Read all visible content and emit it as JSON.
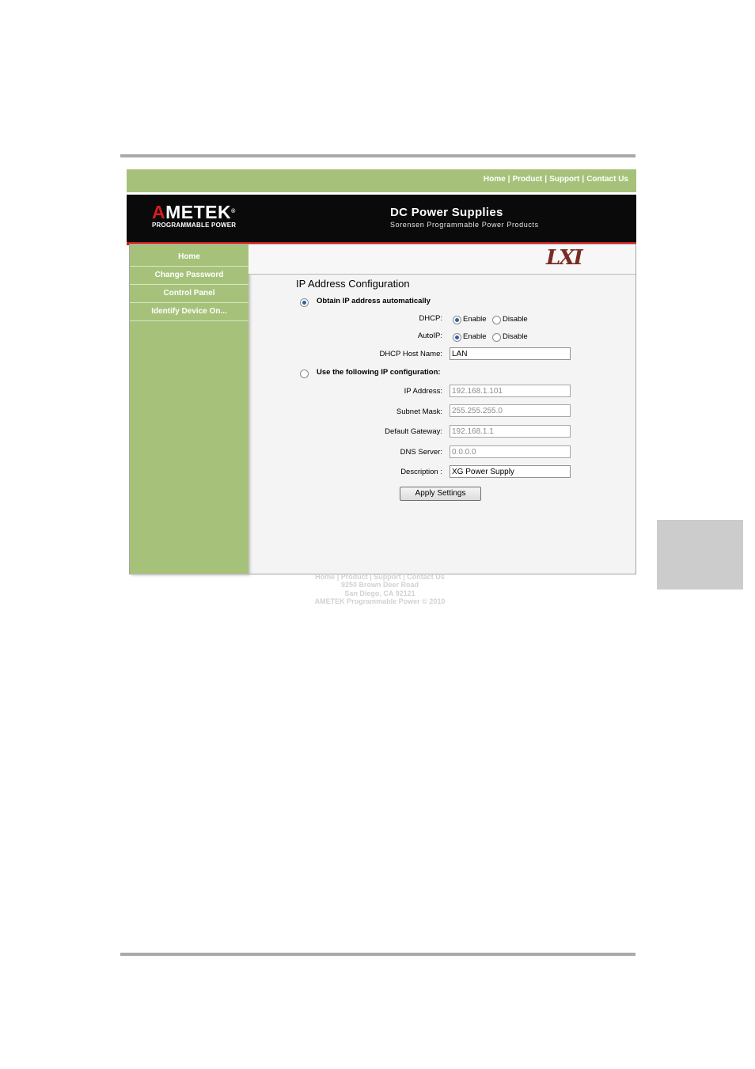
{
  "top_nav": {
    "links": [
      "Home",
      "Product",
      "Support",
      "Contact Us"
    ],
    "separator": "|"
  },
  "brand": {
    "logo_prefix": "A",
    "logo_rest": "METEK",
    "logo_mark": "®",
    "logo_sub": "PROGRAMMABLE POWER",
    "title": "DC Power Supplies",
    "subtitle": "Sorensen Programmable Power Products",
    "lxi": "LXI"
  },
  "sidebar": {
    "items": [
      "Home",
      "Change Password",
      "Control Panel",
      "Identify Device On..."
    ]
  },
  "form": {
    "title": "IP Address Configuration",
    "auto_label": "Obtain IP address automatically",
    "auto_selected": true,
    "dhcp_label": "DHCP:",
    "dhcp_value": "Enable",
    "autoip_label": "AutoIP:",
    "autoip_value": "Enable",
    "enable": "Enable",
    "disable": "Disable",
    "host_label": "DHCP Host Name:",
    "host_value": "LAN",
    "manual_label": "Use the following IP configuration:",
    "manual_selected": false,
    "ip_label": "IP Address:",
    "ip_value": "192.168.1.101",
    "mask_label": "Subnet Mask:",
    "mask_value": "255.255.255.0",
    "gateway_label": "Default Gateway:",
    "gateway_value": "192.168.1.1",
    "dns_label": "DNS Server:",
    "dns_value": "0.0.0.0",
    "desc_label": "Description :",
    "desc_value": "XG Power Supply",
    "apply_label": "Apply Settings"
  },
  "footer": {
    "links": [
      "Home",
      "Product",
      "Support",
      "Contact Us"
    ],
    "address1": "9250 Brown Deer Road",
    "address2": "San Diego, CA 92121",
    "copyright": "AMETEK Programmable Power © 2010"
  },
  "colors": {
    "green": "#a6c27a",
    "banner": "#0a0a0a",
    "accent_red": "#d61e1e",
    "lxi": "#7a2a22"
  }
}
